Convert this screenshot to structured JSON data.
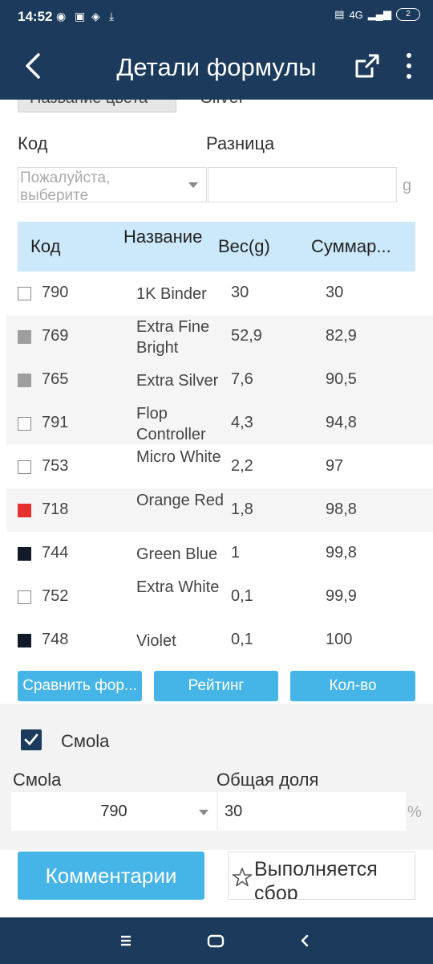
{
  "status_bar": {
    "time": "14:52",
    "network": "4G",
    "battery": "2"
  },
  "app_bar": {
    "title": "Детали формулы"
  },
  "color": {
    "label": "Название цвета",
    "value": "Silver"
  },
  "filters": {
    "code_label": "Код",
    "diff_label": "Разница",
    "code_placeholder": "Пожалуйста, выберите",
    "diff_unit": "g"
  },
  "table": {
    "headers": [
      "Код",
      "Название",
      "Вес(g)",
      "Суммар..."
    ],
    "rows": [
      {
        "swatch": "#ffffff",
        "code": "790",
        "name": "1K Binder",
        "weight": "30",
        "sum": "30"
      },
      {
        "swatch": "#9e9e9e",
        "code": "769",
        "name": "Extra Fine Bright",
        "weight": "52,9",
        "sum": "82,9"
      },
      {
        "swatch": "#9e9e9e",
        "code": "765",
        "name": "Extra Silver",
        "weight": "7,6",
        "sum": "90,5"
      },
      {
        "swatch": "#ffffff",
        "code": "791",
        "name": "Flop Controller",
        "weight": "4,3",
        "sum": "94,8"
      },
      {
        "swatch": "#ffffff",
        "code": "753",
        "name": "Micro White",
        "weight": "2,2",
        "sum": "97"
      },
      {
        "swatch": "#e53030",
        "code": "718",
        "name": "Orange Red",
        "weight": "1,8",
        "sum": "98,8"
      },
      {
        "swatch": "#121a2a",
        "code": "744",
        "name": "Green Blue",
        "weight": "1",
        "sum": "99,8"
      },
      {
        "swatch": "#ffffff",
        "code": "752",
        "name": "Extra White",
        "weight": "0,1",
        "sum": "99,9"
      },
      {
        "swatch": "#121a2a",
        "code": "748",
        "name": "Violet",
        "weight": "0,1",
        "sum": "100"
      }
    ]
  },
  "actions": {
    "compare": "Сравнить фор...",
    "rating": "Рейтинг",
    "quantity": "Кол-во"
  },
  "resin": {
    "checkbox_label": "Смola",
    "resin_label": "Смola",
    "share_label": "Общая доля",
    "selected_code": "790",
    "share_value": "30",
    "share_unit": "%"
  },
  "footer": {
    "comments": "Комментарии",
    "in_progress": "Выполняется сбор"
  },
  "colors": {
    "primary": "#1b3a5c",
    "accent": "#45b5e8",
    "table_header": "#cce9fb"
  }
}
